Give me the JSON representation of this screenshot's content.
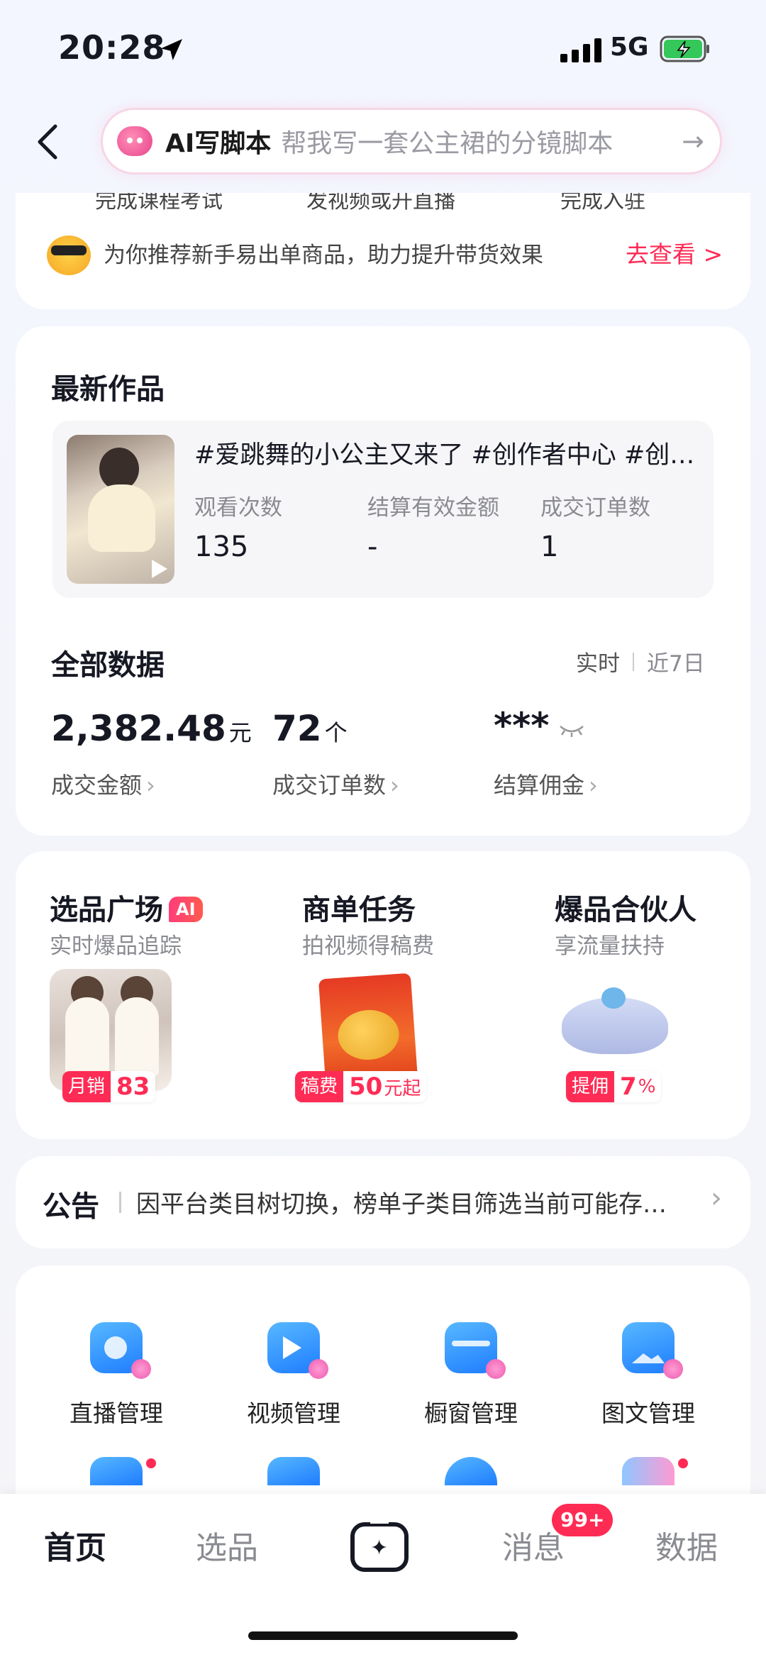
{
  "status_bar": {
    "time": "20:28",
    "network": "5G"
  },
  "header": {
    "ai_label": "AI写脚本",
    "ai_hint": "帮我写一套公主裙的分镜脚本",
    "ai_arrow": "→"
  },
  "task_strip": {
    "cut_items": [
      "完成课程考试",
      "发视频或开直播",
      "完成入驻"
    ],
    "recommend_text": "为你推荐新手易出单商品，助力提升带货效果",
    "recommend_link": "去查看 >"
  },
  "latest_work": {
    "section_title": "最新作品",
    "title": "#爱跳舞的小公主又来了 #创作者中心 #创作者中心",
    "stats": [
      {
        "label": "观看次数",
        "value": "135"
      },
      {
        "label": "结算有效金额",
        "value": "-"
      },
      {
        "label": "成交订单数",
        "value": "1"
      }
    ]
  },
  "all_data": {
    "section_title": "全部数据",
    "toggle": [
      "实时",
      "近7日"
    ],
    "metrics": [
      {
        "value": "2,382.48",
        "unit": "元",
        "label": "成交金额"
      },
      {
        "value": "72",
        "unit": "个",
        "label": "成交订单数"
      },
      {
        "value": "***",
        "unit": "",
        "label": "结算佣金"
      }
    ]
  },
  "features": [
    {
      "title": "选品广场",
      "tag": "AI",
      "subtitle": "实时爆品追踪",
      "badge_key": "月销",
      "badge_value": "83",
      "badge_unit": ""
    },
    {
      "title": "商单任务",
      "tag": "",
      "subtitle": "拍视频得稿费",
      "badge_key": "稿费",
      "badge_value": "50",
      "badge_unit": "元起"
    },
    {
      "title": "爆品合伙人",
      "tag": "",
      "subtitle": "享流量扶持",
      "badge_key": "提佣",
      "badge_value": "7",
      "badge_unit": "%"
    }
  ],
  "notice": {
    "title": "公告",
    "text": "因平台类目树切换，榜单子类目筛选当前可能存在异常"
  },
  "tools": [
    {
      "label": "直播管理",
      "icon": "live-camera-icon"
    },
    {
      "label": "视频管理",
      "icon": "video-play-icon"
    },
    {
      "label": "橱窗管理",
      "icon": "storefront-icon"
    },
    {
      "label": "图文管理",
      "icon": "image-text-icon"
    }
  ],
  "tabbar": {
    "tabs": [
      "首页",
      "选品",
      "消息",
      "数据"
    ],
    "message_badge": "99+",
    "active": "首页"
  },
  "colors": {
    "accent": "#fe2c55",
    "text": "#161823",
    "muted": "#8a8b91"
  }
}
